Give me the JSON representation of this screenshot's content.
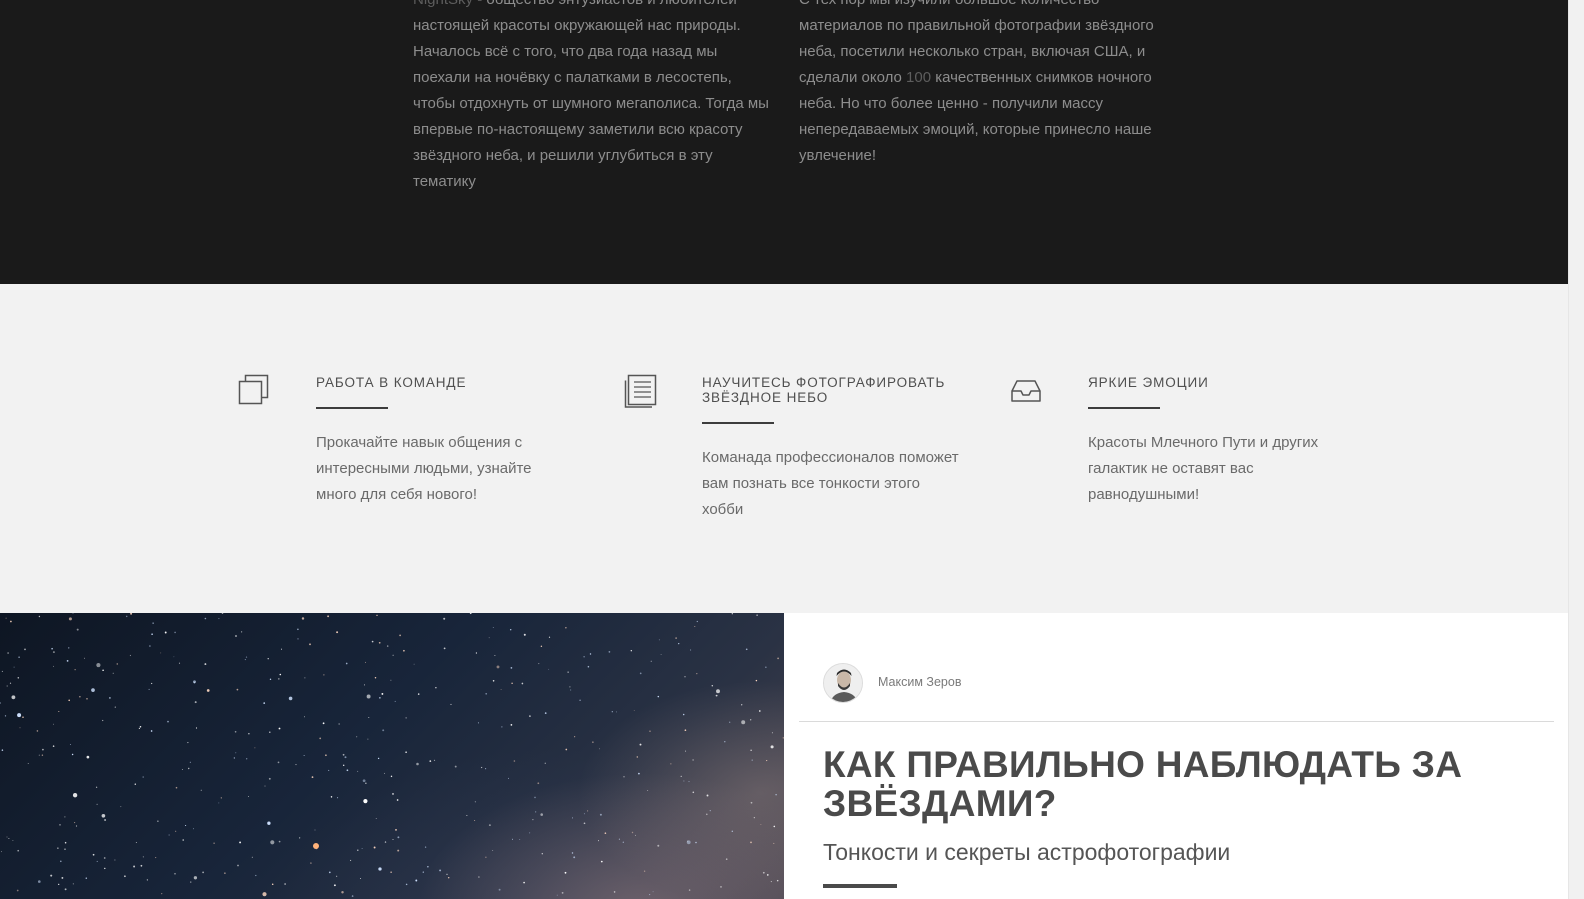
{
  "about": {
    "left_accent": "NightSky",
    "left_text": " - общество энтузиастов и любителей настоящей красоты окружающей нас природы. Началось всё с того, что два года назад мы поехали на ночёвку с палатками в лесостепь, чтобы отдохнуть от шумного мегаполиса. Тогда мы впервые по-настоящему заметили всю красоту звёздного неба, и решили углубиться в эту тематику",
    "right_text_1": "С тех пор мы изучили большое количество материалов по правильной фотографии звёздного неба, посетили несколько стран, включая США, и сделали около ",
    "right_accent": "100",
    "right_text_2": " качественных снимков ночного неба. Но что более ценно - получили массу непередаваемых эмоций, которые принесло наше увлечение!"
  },
  "features": [
    {
      "icon": "copy-icon",
      "title": "Работа в команде",
      "text": "Прокачайте навык общения с интересными людьми, узнайте много для себя нового!"
    },
    {
      "icon": "document-icon",
      "title": "Научитесь фотографировать звёздное небо",
      "text": "Команада профессионалов поможет вам познать все тонкости этого хобби"
    },
    {
      "icon": "inbox-icon",
      "title": "Яркие эмоции",
      "text": "Красоты Млечного Пути и других галактик не оставят вас равнодушными!"
    }
  ],
  "article": {
    "author": "Максим Зеров",
    "title": "Как правильно наблюдать за звёздами?",
    "subtitle": "Тонкости и секреты астрофотографии"
  },
  "colors": {
    "dark_bg": "#1a1a1a",
    "light_bg": "#f2f2f2",
    "text_gray": "#6a6a6a",
    "heading": "#4a4a4a"
  }
}
